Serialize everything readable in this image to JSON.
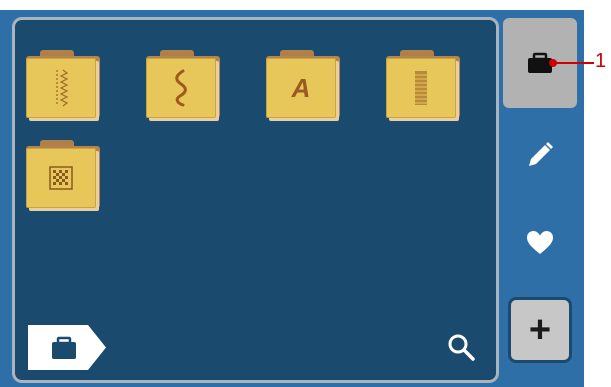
{
  "folders": [
    {
      "name": "stitch-folder",
      "icon": "straight-stitch-icon"
    },
    {
      "name": "zigzag-folder",
      "icon": "zigzag-stitch-icon"
    },
    {
      "name": "alphabet-folder",
      "icon": "letter-a-icon",
      "glyph": "A"
    },
    {
      "name": "satin-folder",
      "icon": "satin-stitch-icon"
    },
    {
      "name": "pattern-folder",
      "icon": "checker-pattern-icon"
    }
  ],
  "sidebar": {
    "items": [
      {
        "name": "folder-tab",
        "icon": "folder-icon",
        "active": true
      },
      {
        "name": "edit-tab",
        "icon": "pencil-icon",
        "active": false
      },
      {
        "name": "favorites-tab",
        "icon": "heart-icon",
        "active": false
      }
    ],
    "add_label": "+"
  },
  "callout": {
    "number": "1"
  },
  "colors": {
    "panel": "#1a4a6e",
    "frame": "#2f6fa8",
    "folder": "#e7c75a",
    "accent": "#d00000"
  }
}
